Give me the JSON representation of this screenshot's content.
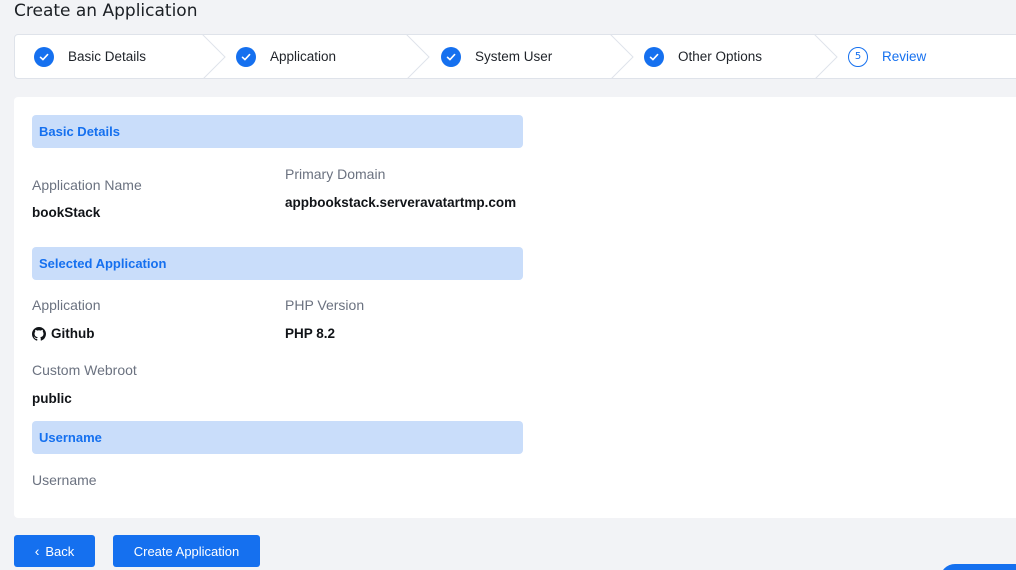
{
  "page": {
    "title": "Create an Application"
  },
  "steps": [
    {
      "label": "Basic Details",
      "status": "complete"
    },
    {
      "label": "Application",
      "status": "complete"
    },
    {
      "label": "System User",
      "status": "complete"
    },
    {
      "label": "Other Options",
      "status": "complete"
    },
    {
      "label": "Review",
      "status": "active",
      "number": "5"
    }
  ],
  "review": {
    "basic": {
      "heading": "Basic Details",
      "app_name_label": "Application Name",
      "app_name": "bookStack",
      "domain_label": "Primary Domain",
      "domain": "appbookstack.serveravatartmp.com"
    },
    "selected": {
      "heading": "Selected Application",
      "application_label": "Application",
      "application": "Github",
      "php_label": "PHP Version",
      "php": "PHP 8.2",
      "webroot_label": "Custom Webroot",
      "webroot": "public"
    },
    "user": {
      "heading": "Username",
      "username_label": "Username"
    }
  },
  "actions": {
    "back_label": "Back",
    "back_icon": "‹",
    "create_label": "Create Application"
  },
  "colors": {
    "accent": "#1570ef",
    "section_bg": "#c9ddfa",
    "page_bg": "#f2f3f6"
  }
}
